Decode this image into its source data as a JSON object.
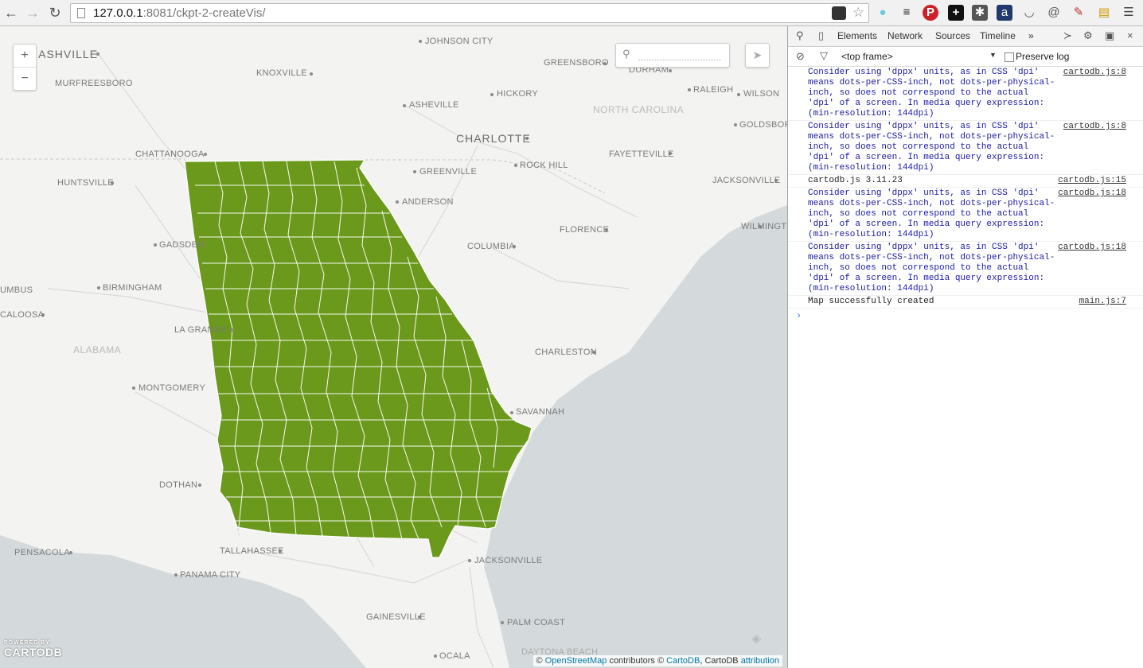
{
  "browser": {
    "url_host": "127.0.0.1",
    "url_rest": ":8081/ckpt-2-createVis/"
  },
  "map": {
    "zoom_in": "+",
    "zoom_out": "−",
    "county_fill": "#6b991b",
    "cities": {
      "nashville": "NASHVILLE",
      "johnson_city": "JOHNSON CITY",
      "greensboro": "GREENSBORO",
      "durham": "DURHAM",
      "knoxville": "KNOXVILLE",
      "murfreesboro": "MURFREESBORO",
      "raleigh": "RALEIGH",
      "wilson": "WILSON",
      "hickory": "HICKORY",
      "asheville": "ASHEVILLE",
      "charlotte": "CHARLOTTE",
      "goldsboro": "GOLDSBORO",
      "chattanooga": "CHATTANOOGA",
      "fayetteville": "FAYETTEVILLE",
      "rock_hill": "ROCK HILL",
      "greenville": "GREENVILLE",
      "huntsville": "HUNTSVILLE",
      "jacksonville_nc": "JACKSONVILLE",
      "anderson": "ANDERSON",
      "florence": "FLORENCE",
      "wilmington": "WILMINGT",
      "gadsden": "GADSDEN",
      "columbia": "COLUMBIA",
      "birmingham": "BIRMINGHAM",
      "columbus": "UMBUS",
      "tuscaloosa": "CALOOSA",
      "la_grange": "LA GRANGE",
      "charleston": "CHARLESTON",
      "montgomery": "MONTGOMERY",
      "savannah": "SAVANNAH",
      "dothan": "DOTHAN",
      "pensacola": "PENSACOLA",
      "tallahassee": "TALLAHASSEE",
      "jacksonville_fl": "JACKSONVILLE",
      "panama_city": "PANAMA CITY",
      "gainesville": "GAINESVILLE",
      "palm_coast": "PALM COAST",
      "ocala": "OCALA",
      "daytona": "DAYTONA BEACH"
    },
    "states": {
      "north_carolina": "NORTH CAROLINA",
      "alabama": "ALABAMA"
    },
    "logo_small": "POWERED BY",
    "logo_big": "CARTODB",
    "attribution": {
      "prefix": "©",
      "osm": "OpenStreetMap",
      "mid": "contributors ©",
      "cartodb": "CartoDB",
      "mid2": ", CartoDB",
      "attr": "attribution"
    }
  },
  "devtools": {
    "tabs": [
      "Elements",
      "Network",
      "Sources",
      "Timeline"
    ],
    "more": "»",
    "frame": "<top frame>",
    "preserve_log": "Preserve log",
    "messages": [
      {
        "text": "Consider using 'dppx' units, as in CSS 'dpi' means dots-per-CSS-inch, not dots-per-physical-inch, so does not correspond to the actual 'dpi' of a screen. In media query expression: (min-resolution: 144dpi)",
        "source": "cartodb.js:8",
        "kind": "warn"
      },
      {
        "text": "Consider using 'dppx' units, as in CSS 'dpi' means dots-per-CSS-inch, not dots-per-physical-inch, so does not correspond to the actual 'dpi' of a screen. In media query expression: (min-resolution: 144dpi)",
        "source": "cartodb.js:8",
        "kind": "warn"
      },
      {
        "text": "cartodb.js 3.11.23",
        "source": "cartodb.js:15",
        "kind": "log"
      },
      {
        "text": "Consider using 'dppx' units, as in CSS 'dpi' means dots-per-CSS-inch, not dots-per-physical-inch, so does not correspond to the actual 'dpi' of a screen. In media query expression: (min-resolution: 144dpi)",
        "source": "cartodb.js:18",
        "kind": "warn"
      },
      {
        "text": "Consider using 'dppx' units, as in CSS 'dpi' means dots-per-CSS-inch, not dots-per-physical-inch, so does not correspond to the actual 'dpi' of a screen. In media query expression: (min-resolution: 144dpi)",
        "source": "cartodb.js:18",
        "kind": "warn"
      },
      {
        "text": "Map successfully created",
        "source": "main.js:7",
        "kind": "log"
      }
    ],
    "prompt": "›"
  }
}
